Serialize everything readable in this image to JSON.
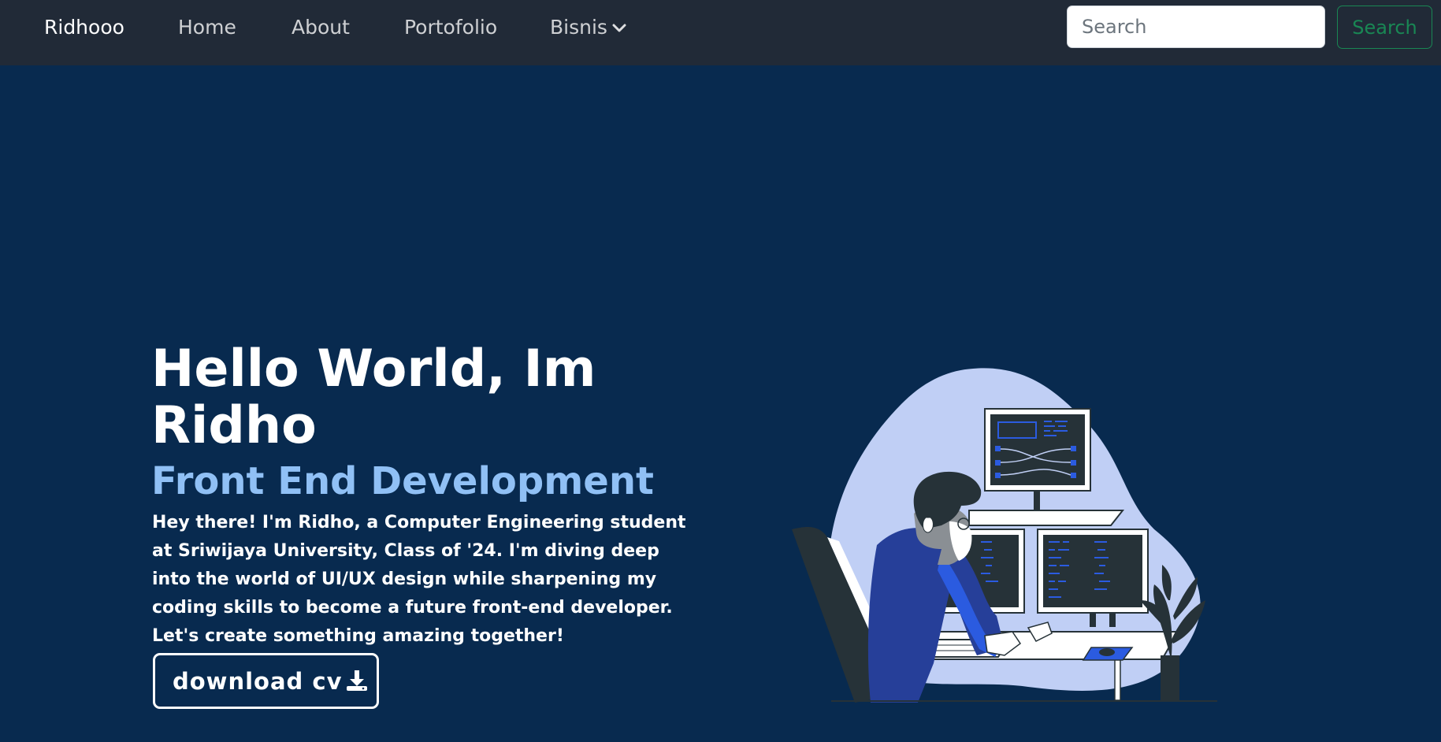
{
  "navbar": {
    "brand": "Ridhooo",
    "links": [
      {
        "label": "Home"
      },
      {
        "label": "About"
      },
      {
        "label": "Portofolio"
      },
      {
        "label": "Bisnis"
      }
    ],
    "search": {
      "placeholder": "Search",
      "value": "",
      "button_label": "Search"
    }
  },
  "hero": {
    "title": "Hello World, Im Ridho",
    "subtitle": "Front End Development",
    "description": "Hey there! I'm Ridho, a Computer Engineering student at Sriwijaya University, Class of '24. I'm diving deep into the world of UI/UX design while sharpening my coding skills to become a future front-end developer. Let's create something amazing together!",
    "cv_button_label": "download cv",
    "cv_button_icon": "download-icon",
    "illustration": "developer-at-desk-illustration"
  },
  "colors": {
    "navbar_bg": "#212a37",
    "page_bg": "#082a4f",
    "subtitle": "#90c0f5",
    "search_button": "#198754",
    "illustration_blob": "#c0cff5",
    "illustration_accent": "#2b5be0"
  }
}
